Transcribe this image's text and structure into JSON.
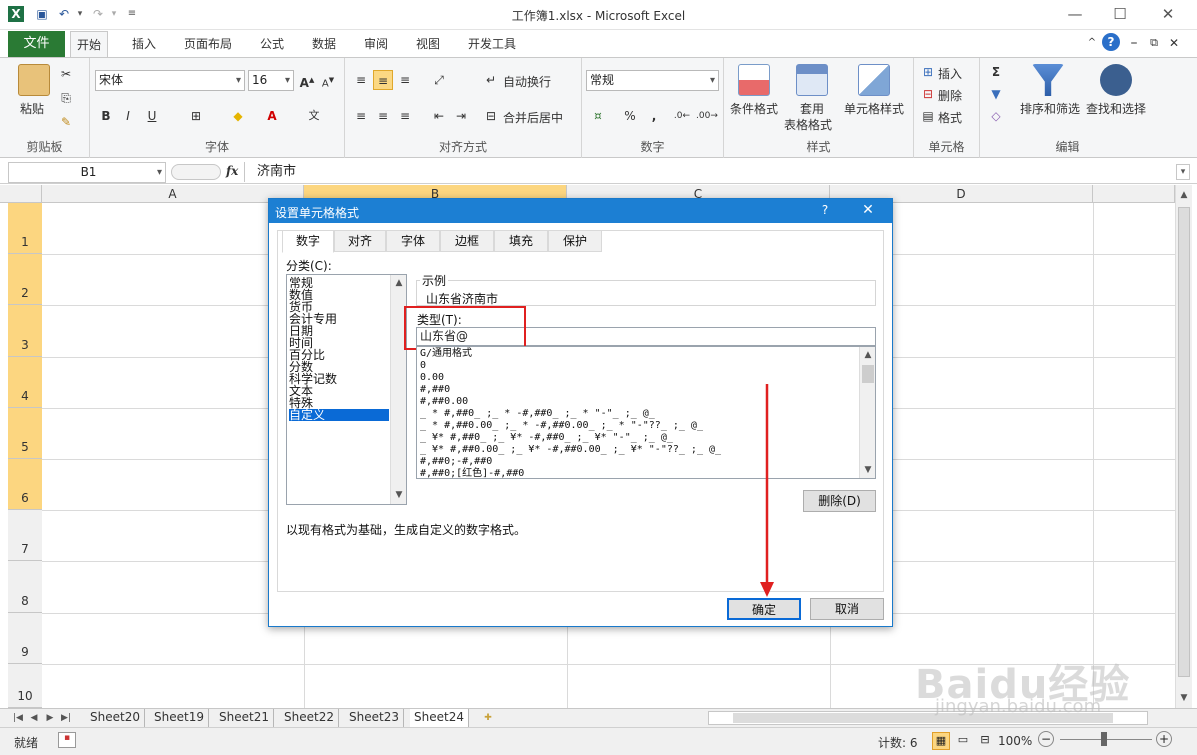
{
  "window": {
    "title": "工作簿1.xlsx - Microsoft Excel"
  },
  "ribbon_tabs": {
    "file": "文件",
    "home": "开始",
    "insert": "插入",
    "layout": "页面布局",
    "formulas": "公式",
    "data": "数据",
    "review": "审阅",
    "view": "视图",
    "developer": "开发工具"
  },
  "ribbon": {
    "clipboard": {
      "label": "剪贴板",
      "paste": "粘贴"
    },
    "font": {
      "label": "字体",
      "name": "宋体",
      "size": "16",
      "bold": "B",
      "italic": "I",
      "underline": "U"
    },
    "alignment": {
      "label": "对齐方式",
      "wrap": "自动换行",
      "merge": "合并后居中"
    },
    "number": {
      "label": "数字",
      "format": "常规",
      "percent": "%",
      "comma": ","
    },
    "styles": {
      "label": "样式",
      "conditional": "条件格式",
      "table_line1": "套用",
      "table_line2": "表格格式",
      "cell_styles": "单元格样式"
    },
    "cells": {
      "label": "单元格",
      "insert": "插入",
      "delete": "删除",
      "format": "格式"
    },
    "editing": {
      "label": "编辑",
      "sum": "Σ",
      "sort": "排序和筛选",
      "find": "查找和选择"
    }
  },
  "formula_bar": {
    "name_box": "B1",
    "fx": "fx",
    "content": "济南市"
  },
  "columns": [
    "A",
    "B",
    "C",
    "D"
  ],
  "rows": [
    "1",
    "2",
    "3",
    "4",
    "5",
    "6",
    "7",
    "8",
    "9",
    "10"
  ],
  "sheets": [
    "Sheet20",
    "Sheet19",
    "Sheet21",
    "Sheet22",
    "Sheet23",
    "Sheet24"
  ],
  "status": {
    "ready": "就绪",
    "count": "计数: 6",
    "zoom": "100%"
  },
  "dialog": {
    "title": "设置单元格格式",
    "help": "?",
    "close": "✕",
    "tabs": [
      "数字",
      "对齐",
      "字体",
      "边框",
      "填充",
      "保护"
    ],
    "category_label": "分类(C):",
    "categories": [
      "常规",
      "数值",
      "货币",
      "会计专用",
      "日期",
      "时间",
      "百分比",
      "分数",
      "科学记数",
      "文本",
      "特殊",
      "自定义"
    ],
    "sample_label": "示例",
    "sample_value": "山东省济南市",
    "type_label": "类型(T):",
    "type_value": "山东省@",
    "formats": [
      "G/通用格式",
      "0",
      "0.00",
      "#,##0",
      "#,##0.00",
      "_ * #,##0_ ;_ * -#,##0_ ;_ * \"-\"_ ;_ @_",
      "_ * #,##0.00_ ;_ * -#,##0.00_ ;_ * \"-\"??_ ;_ @_",
      "_ ¥* #,##0_ ;_ ¥* -#,##0_ ;_ ¥* \"-\"_ ;_ @_",
      "_ ¥* #,##0.00_ ;_ ¥* -#,##0.00_ ;_ ¥* \"-\"??_ ;_ @_",
      "#,##0;-#,##0",
      "#,##0;[红色]-#,##0"
    ],
    "delete": "删除(D)",
    "description": "以现有格式为基础，生成自定义的数字格式。",
    "ok": "确定",
    "cancel": "取消",
    "highlight_color": "#e02020"
  },
  "watermark": {
    "brand": "Baidu经验",
    "url": "jingyan.baidu.com"
  }
}
